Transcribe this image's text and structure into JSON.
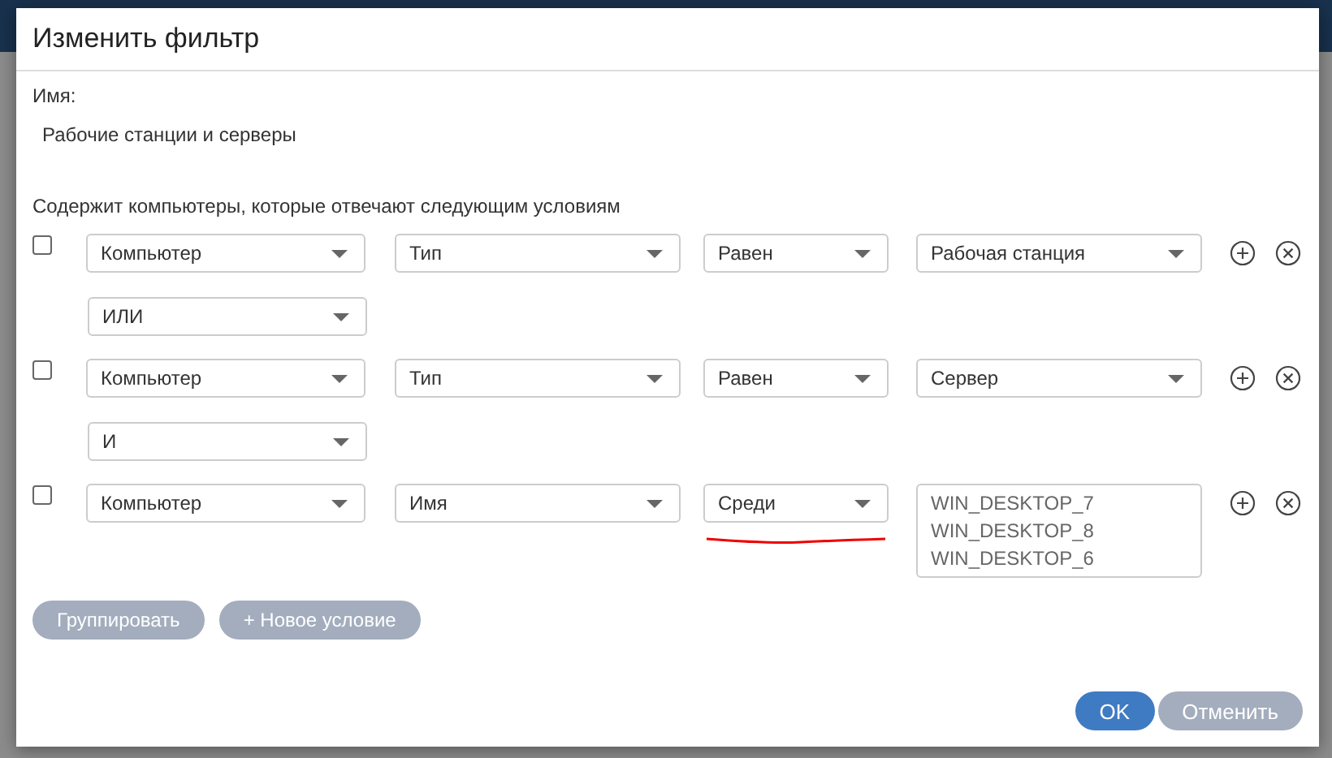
{
  "dialog": {
    "title": "Изменить фильтр",
    "name_label": "Имя:",
    "name_value": "Рабочие станции и серверы",
    "conditions_heading": "Содержит компьютеры, которые отвечают следующим условиям",
    "conditions": [
      {
        "checked": false,
        "field": "Компьютер",
        "property": "Тип",
        "operator": "Равен",
        "underlined": false,
        "value": "Рабочая станция",
        "logic": "ИЛИ"
      },
      {
        "checked": false,
        "field": "Компьютер",
        "property": "Тип",
        "operator": "Равен",
        "underlined": false,
        "value": "Сервер",
        "logic": "И"
      },
      {
        "checked": false,
        "field": "Компьютер",
        "property": "Имя",
        "operator": "Среди",
        "underlined": true,
        "values": [
          "WIN_DESKTOP_7",
          "WIN_DESKTOP_8",
          "WIN_DESKTOP_6"
        ]
      }
    ],
    "group_button": "Группировать",
    "add_button": "+ Новое условие",
    "ok_button": "OK",
    "cancel_button": "Отменить"
  }
}
